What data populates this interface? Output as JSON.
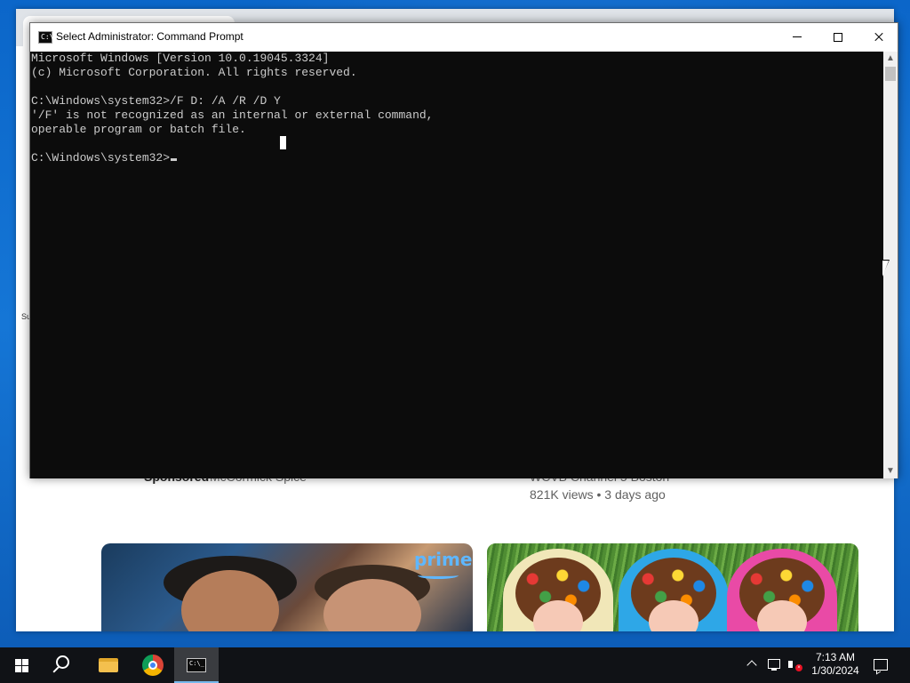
{
  "cmd_window": {
    "title": "Select Administrator: Command Prompt",
    "icon": "cmd-icon",
    "icon_glyph": "C:\\_",
    "lines": [
      "Microsoft Windows [Version 10.0.19045.3324]",
      "(c) Microsoft Corporation. All rights reserved.",
      "",
      "C:\\Windows\\system32>/F D: /A /R /D Y",
      "'/F' is not recognized as an internal or external command,",
      "operable program or batch file.",
      ""
    ],
    "prompt": "C:\\Windows\\system32>"
  },
  "browser_bg": {
    "side_text": "Su",
    "card_left": {
      "sponsored": "Sponsored",
      "advertiser": "McCormick Spice"
    },
    "card_right": {
      "channel": "WCVB Channel 5 Boston",
      "meta": "821K views • 3 days ago"
    },
    "thumb_left_badge": "prime"
  },
  "taskbar": {
    "apps": [
      {
        "name": "Start",
        "icon": "windows-logo-icon"
      },
      {
        "name": "Search",
        "icon": "search-icon"
      },
      {
        "name": "File Explorer",
        "icon": "folder-icon"
      },
      {
        "name": "Google Chrome",
        "icon": "chrome-icon"
      },
      {
        "name": "Command Prompt",
        "icon": "cmd-icon",
        "active": true
      }
    ],
    "clock": {
      "time": "7:13 AM",
      "date": "1/30/2024"
    },
    "volume_badge": "×"
  },
  "colors": {
    "console_bg": "#0c0c0c",
    "console_fg": "#cccccc",
    "taskbar_bg": "#101216",
    "wallpaper": "#1576d6"
  }
}
